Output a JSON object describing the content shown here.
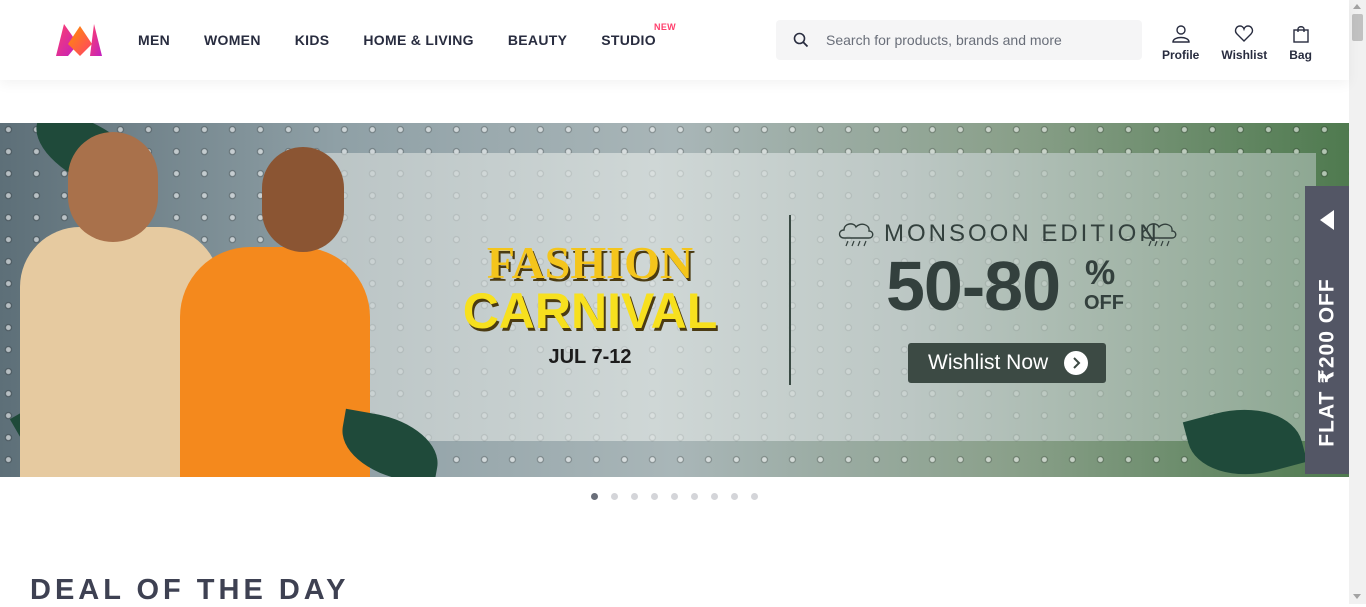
{
  "header": {
    "nav": [
      {
        "label": "MEN"
      },
      {
        "label": "WOMEN"
      },
      {
        "label": "KIDS"
      },
      {
        "label": "HOME & LIVING"
      },
      {
        "label": "BEAUTY"
      },
      {
        "label": "STUDIO",
        "badge": "NEW"
      }
    ],
    "search": {
      "placeholder": "Search for products, brands and more"
    },
    "actions": {
      "profile": "Profile",
      "wishlist": "Wishlist",
      "bag": "Bag"
    },
    "accent_color": "#ff3f6c"
  },
  "banner": {
    "title_line1": "FASHION",
    "title_line2": "CARNIVAL",
    "dates": "JUL 7-12",
    "edition": "MONSOON EDITION",
    "discount": "50-80",
    "percent": "%",
    "off": "OFF",
    "cta": "Wishlist Now",
    "side_promo": "FLAT ₹200 OFF"
  },
  "carousel": {
    "total_slides": 9,
    "active_index": 0
  },
  "sections": {
    "deal_title": "DEAL OF THE DAY"
  },
  "icons": [
    "myntra-logo-icon",
    "search-icon",
    "profile-icon",
    "wishlist-heart-icon",
    "bag-icon",
    "chevron-right-icon",
    "triangle-left-icon",
    "rain-cloud-icon"
  ]
}
